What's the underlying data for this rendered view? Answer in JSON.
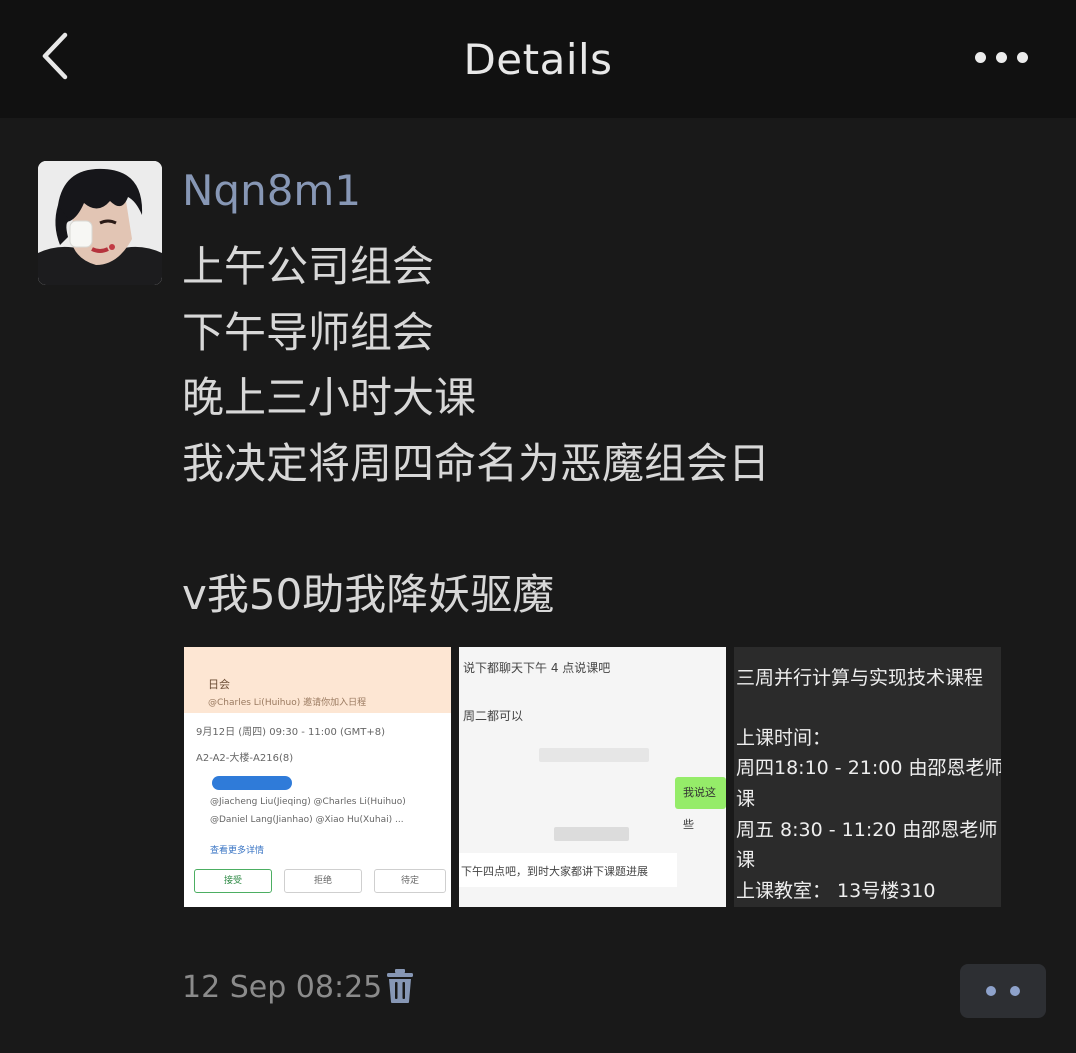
{
  "header": {
    "title": "Details"
  },
  "post": {
    "username": "Nqn8m1",
    "lines": [
      "上午公司组会",
      "下午导师组会",
      "晚上三小时大课",
      "我决定将周四命名为恶魔组会日",
      "",
      "v我50助我降妖驱魔"
    ],
    "timestamp": "12 Sep 08:25"
  },
  "images": [
    {
      "caption_title": "日会",
      "caption_sub": "@Charles Li(Huihuo) 邀请你加入日程",
      "rows": [
        "9月12日 (周四) 09:30 - 11:00 (GMT+8)",
        "A2-A2-大楼-A216(8)",
        "@Jiacheng Liu(Jieqing)  @Charles Li(Huihuo)",
        "@Daniel Lang(Jianhao)  @Xiao Hu(Xuhai) ...",
        "查看更多详情"
      ],
      "buttons": [
        "接受",
        "拒绝",
        "待定"
      ]
    },
    {
      "lines": [
        "说下都聊天下午 4 点说课吧",
        "周二都可以",
        "我说这些",
        "下午四点吧，到时大家都讲下课题进展"
      ]
    },
    {
      "lines": [
        "三周并行计算与实现技术课程",
        "",
        "上课时间：",
        "周四18:10 - 21:00 由邵恩老师",
        "课",
        "周五  8:30 - 11:20 由邵恩老师",
        "课",
        "上课教室：  13号楼310"
      ]
    }
  ],
  "icons": {
    "back": "back-arrow-icon",
    "more": "more-dots-icon",
    "trash": "trash-icon",
    "comment": "comment-dots-icon"
  },
  "colors": {
    "background": "#191919",
    "topbar": "#111111",
    "username": "#8797b5",
    "comment_dots": "#8ea2cb"
  }
}
